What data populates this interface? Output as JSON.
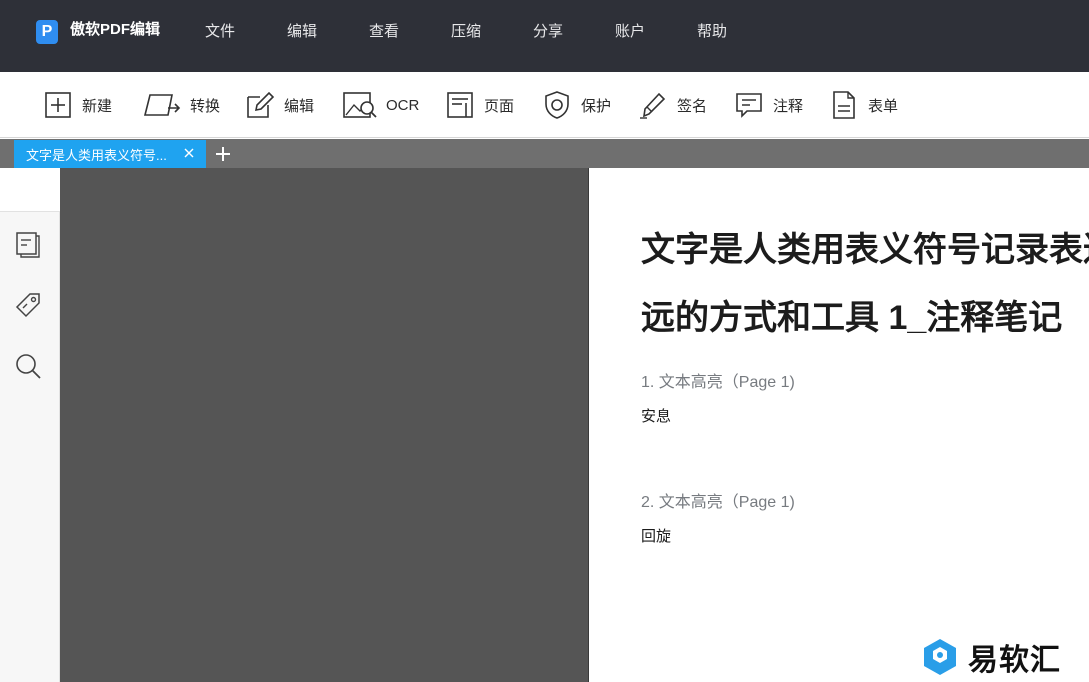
{
  "app": {
    "logo_letter": "P",
    "title": "傲软PDF编辑",
    "accent_color": "#1fa3f0"
  },
  "menu": {
    "items": [
      "文件",
      "编辑",
      "查看",
      "压缩",
      "分享",
      "账户",
      "帮助"
    ]
  },
  "toolbar": {
    "items": [
      {
        "label": "新建",
        "icon": "new-icon"
      },
      {
        "label": "转换",
        "icon": "convert-icon"
      },
      {
        "label": "编辑",
        "icon": "edit-icon"
      },
      {
        "label": "OCR",
        "icon": "ocr-icon"
      },
      {
        "label": "页面",
        "icon": "page-icon"
      },
      {
        "label": "保护",
        "icon": "protect-icon"
      },
      {
        "label": "签名",
        "icon": "sign-icon"
      },
      {
        "label": "注释",
        "icon": "comment-icon"
      },
      {
        "label": "表单",
        "icon": "form-icon"
      }
    ]
  },
  "tabs": {
    "active_label": "文字是人类用表义符号...",
    "close_icon": "close-icon",
    "add_icon": "plus-icon"
  },
  "sidebar": {
    "items": [
      {
        "icon": "thumbnail-icon"
      },
      {
        "icon": "tag-icon"
      },
      {
        "icon": "search-icon"
      }
    ]
  },
  "document": {
    "title_line1": "文字是人类用表义符号记录表达",
    "title_line2": "远的方式和工具 1_注释笔记",
    "notes": [
      {
        "heading": "1. 文本高亮（Page 1)",
        "text": "安息"
      },
      {
        "heading": "2. 文本高亮（Page 1)",
        "text": "回旋"
      }
    ]
  },
  "watermark": {
    "text": "易软汇"
  }
}
